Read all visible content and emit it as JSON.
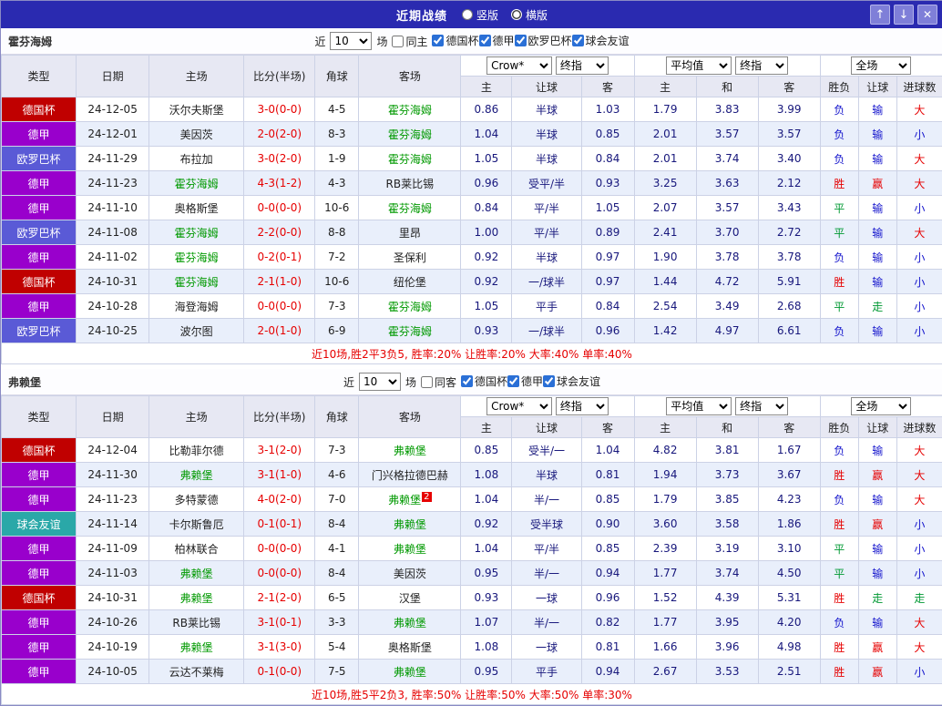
{
  "title_bar": {
    "title": "近期战绩",
    "layout_options": [
      {
        "label": "竖版",
        "selected": false
      },
      {
        "label": "横版",
        "selected": true
      }
    ],
    "buttons": {
      "up": "↑",
      "down": "↓",
      "close": "✕"
    }
  },
  "colors": {
    "red": "#e60000",
    "blue": "#1414cc",
    "green": "#009933",
    "league": {
      "德国杯": "#c00000",
      "德甲": "#9900cc",
      "欧罗巴杯": "#5a5ad6",
      "球会友谊": "#2aa8a8"
    }
  },
  "columns": {
    "type": "类型",
    "date": "日期",
    "home": "主场",
    "score": "比分(半场)",
    "corner": "角球",
    "away": "客场",
    "odds": [
      "主",
      "让球",
      "客"
    ],
    "avg": [
      "主",
      "和",
      "客"
    ],
    "result": [
      "胜负",
      "让球",
      "进球数"
    ]
  },
  "sections": [
    {
      "team": "霍芬海姆",
      "filter": {
        "near_label": "近",
        "count": "10",
        "games_label": "场",
        "same_label": "同主",
        "same_checked": false,
        "leagues": [
          {
            "label": "德国杯",
            "checked": true
          },
          {
            "label": "德甲",
            "checked": true
          },
          {
            "label": "欧罗巴杯",
            "checked": true
          },
          {
            "label": "球会友谊",
            "checked": true
          }
        ]
      },
      "selects": {
        "company": "Crow*",
        "company_time": "终指",
        "avg": "平均值",
        "avg_time": "终指",
        "scope": "全场"
      },
      "rows": [
        {
          "type": "德国杯",
          "date": "24-12-05",
          "home": "沃尔夫斯堡",
          "home_subject": false,
          "score": "3-0(0-0)",
          "corner": "4-5",
          "away": "霍芬海姆",
          "away_subject": true,
          "odds": [
            "0.86",
            "半球",
            "1.03"
          ],
          "avg": [
            "1.79",
            "3.83",
            "3.99"
          ],
          "results": [
            [
              "负",
              "blue"
            ],
            [
              "输",
              "blue"
            ],
            [
              "大",
              "red"
            ]
          ]
        },
        {
          "type": "德甲",
          "date": "24-12-01",
          "home": "美因茨",
          "home_subject": false,
          "score": "2-0(2-0)",
          "corner": "8-3",
          "away": "霍芬海姆",
          "away_subject": true,
          "odds": [
            "1.04",
            "半球",
            "0.85"
          ],
          "avg": [
            "2.01",
            "3.57",
            "3.57"
          ],
          "results": [
            [
              "负",
              "blue"
            ],
            [
              "输",
              "blue"
            ],
            [
              "小",
              "blue"
            ]
          ]
        },
        {
          "type": "欧罗巴杯",
          "date": "24-11-29",
          "home": "布拉加",
          "home_subject": false,
          "score": "3-0(2-0)",
          "corner": "1-9",
          "away": "霍芬海姆",
          "away_subject": true,
          "odds": [
            "1.05",
            "半球",
            "0.84"
          ],
          "avg": [
            "2.01",
            "3.74",
            "3.40"
          ],
          "results": [
            [
              "负",
              "blue"
            ],
            [
              "输",
              "blue"
            ],
            [
              "大",
              "red"
            ]
          ]
        },
        {
          "type": "德甲",
          "date": "24-11-23",
          "home": "霍芬海姆",
          "home_subject": true,
          "score": "4-3(1-2)",
          "corner": "4-3",
          "away": "RB莱比锡",
          "away_subject": false,
          "odds": [
            "0.96",
            "受平/半",
            "0.93"
          ],
          "avg": [
            "3.25",
            "3.63",
            "2.12"
          ],
          "results": [
            [
              "胜",
              "red"
            ],
            [
              "赢",
              "red"
            ],
            [
              "大",
              "red"
            ]
          ]
        },
        {
          "type": "德甲",
          "date": "24-11-10",
          "home": "奥格斯堡",
          "home_subject": false,
          "score": "0-0(0-0)",
          "corner": "10-6",
          "away": "霍芬海姆",
          "away_subject": true,
          "odds": [
            "0.84",
            "平/半",
            "1.05"
          ],
          "avg": [
            "2.07",
            "3.57",
            "3.43"
          ],
          "results": [
            [
              "平",
              "green"
            ],
            [
              "输",
              "blue"
            ],
            [
              "小",
              "blue"
            ]
          ]
        },
        {
          "type": "欧罗巴杯",
          "date": "24-11-08",
          "home": "霍芬海姆",
          "home_subject": true,
          "score": "2-2(0-0)",
          "corner": "8-8",
          "away": "里昂",
          "away_subject": false,
          "odds": [
            "1.00",
            "平/半",
            "0.89"
          ],
          "avg": [
            "2.41",
            "3.70",
            "2.72"
          ],
          "results": [
            [
              "平",
              "green"
            ],
            [
              "输",
              "blue"
            ],
            [
              "大",
              "red"
            ]
          ]
        },
        {
          "type": "德甲",
          "date": "24-11-02",
          "home": "霍芬海姆",
          "home_subject": true,
          "score": "0-2(0-1)",
          "corner": "7-2",
          "away": "圣保利",
          "away_subject": false,
          "odds": [
            "0.92",
            "半球",
            "0.97"
          ],
          "avg": [
            "1.90",
            "3.78",
            "3.78"
          ],
          "results": [
            [
              "负",
              "blue"
            ],
            [
              "输",
              "blue"
            ],
            [
              "小",
              "blue"
            ]
          ]
        },
        {
          "type": "德国杯",
          "date": "24-10-31",
          "home": "霍芬海姆",
          "home_subject": true,
          "score": "2-1(1-0)",
          "corner": "10-6",
          "away": "纽伦堡",
          "away_subject": false,
          "odds": [
            "0.92",
            "一/球半",
            "0.97"
          ],
          "avg": [
            "1.44",
            "4.72",
            "5.91"
          ],
          "results": [
            [
              "胜",
              "red"
            ],
            [
              "输",
              "blue"
            ],
            [
              "小",
              "blue"
            ]
          ]
        },
        {
          "type": "德甲",
          "date": "24-10-28",
          "home": "海登海姆",
          "home_subject": false,
          "score": "0-0(0-0)",
          "corner": "7-3",
          "away": "霍芬海姆",
          "away_subject": true,
          "odds": [
            "1.05",
            "平手",
            "0.84"
          ],
          "avg": [
            "2.54",
            "3.49",
            "2.68"
          ],
          "results": [
            [
              "平",
              "green"
            ],
            [
              "走",
              "green"
            ],
            [
              "小",
              "blue"
            ]
          ]
        },
        {
          "type": "欧罗巴杯",
          "date": "24-10-25",
          "home": "波尔图",
          "home_subject": false,
          "score": "2-0(1-0)",
          "corner": "6-9",
          "away": "霍芬海姆",
          "away_subject": true,
          "odds": [
            "0.93",
            "一/球半",
            "0.96"
          ],
          "avg": [
            "1.42",
            "4.97",
            "6.61"
          ],
          "results": [
            [
              "负",
              "blue"
            ],
            [
              "输",
              "blue"
            ],
            [
              "小",
              "blue"
            ]
          ]
        }
      ],
      "summary": "近10场,胜2平3负5, 胜率:20% 让胜率:20% 大率:40% 单率:40%"
    },
    {
      "team": "弗赖堡",
      "filter": {
        "near_label": "近",
        "count": "10",
        "games_label": "场",
        "same_label": "同客",
        "same_checked": false,
        "leagues": [
          {
            "label": "德国杯",
            "checked": true
          },
          {
            "label": "德甲",
            "checked": true
          },
          {
            "label": "球会友谊",
            "checked": true
          }
        ]
      },
      "selects": {
        "company": "Crow*",
        "company_time": "终指",
        "avg": "平均值",
        "avg_time": "终指",
        "scope": "全场"
      },
      "rows": [
        {
          "type": "德国杯",
          "date": "24-12-04",
          "home": "比勒菲尔德",
          "home_subject": false,
          "score": "3-1(2-0)",
          "corner": "7-3",
          "away": "弗赖堡",
          "away_subject": true,
          "odds": [
            "0.85",
            "受半/一",
            "1.04"
          ],
          "avg": [
            "4.82",
            "3.81",
            "1.67"
          ],
          "results": [
            [
              "负",
              "blue"
            ],
            [
              "输",
              "blue"
            ],
            [
              "大",
              "red"
            ]
          ]
        },
        {
          "type": "德甲",
          "date": "24-11-30",
          "home": "弗赖堡",
          "home_subject": true,
          "score": "3-1(1-0)",
          "corner": "4-6",
          "away": "门兴格拉德巴赫",
          "away_subject": false,
          "odds": [
            "1.08",
            "半球",
            "0.81"
          ],
          "avg": [
            "1.94",
            "3.73",
            "3.67"
          ],
          "results": [
            [
              "胜",
              "red"
            ],
            [
              "赢",
              "red"
            ],
            [
              "大",
              "red"
            ]
          ]
        },
        {
          "type": "德甲",
          "date": "24-11-23",
          "home": "多特蒙德",
          "home_subject": false,
          "score": "4-0(2-0)",
          "corner": "7-0",
          "away": "弗赖堡",
          "away_subject": true,
          "away_badge": "2",
          "odds": [
            "1.04",
            "半/一",
            "0.85"
          ],
          "avg": [
            "1.79",
            "3.85",
            "4.23"
          ],
          "results": [
            [
              "负",
              "blue"
            ],
            [
              "输",
              "blue"
            ],
            [
              "大",
              "red"
            ]
          ]
        },
        {
          "type": "球会友谊",
          "date": "24-11-14",
          "home": "卡尔斯鲁厄",
          "home_subject": false,
          "score": "0-1(0-1)",
          "corner": "8-4",
          "away": "弗赖堡",
          "away_subject": true,
          "odds": [
            "0.92",
            "受半球",
            "0.90"
          ],
          "avg": [
            "3.60",
            "3.58",
            "1.86"
          ],
          "results": [
            [
              "胜",
              "red"
            ],
            [
              "赢",
              "red"
            ],
            [
              "小",
              "blue"
            ]
          ]
        },
        {
          "type": "德甲",
          "date": "24-11-09",
          "home": "柏林联合",
          "home_subject": false,
          "score": "0-0(0-0)",
          "corner": "4-1",
          "away": "弗赖堡",
          "away_subject": true,
          "odds": [
            "1.04",
            "平/半",
            "0.85"
          ],
          "avg": [
            "2.39",
            "3.19",
            "3.10"
          ],
          "results": [
            [
              "平",
              "green"
            ],
            [
              "输",
              "blue"
            ],
            [
              "小",
              "blue"
            ]
          ]
        },
        {
          "type": "德甲",
          "date": "24-11-03",
          "home": "弗赖堡",
          "home_subject": true,
          "score": "0-0(0-0)",
          "corner": "8-4",
          "away": "美因茨",
          "away_subject": false,
          "odds": [
            "0.95",
            "半/一",
            "0.94"
          ],
          "avg": [
            "1.77",
            "3.74",
            "4.50"
          ],
          "results": [
            [
              "平",
              "green"
            ],
            [
              "输",
              "blue"
            ],
            [
              "小",
              "blue"
            ]
          ]
        },
        {
          "type": "德国杯",
          "date": "24-10-31",
          "home": "弗赖堡",
          "home_subject": true,
          "score": "2-1(2-0)",
          "corner": "6-5",
          "away": "汉堡",
          "away_subject": false,
          "odds": [
            "0.93",
            "一球",
            "0.96"
          ],
          "avg": [
            "1.52",
            "4.39",
            "5.31"
          ],
          "results": [
            [
              "胜",
              "red"
            ],
            [
              "走",
              "green"
            ],
            [
              "走",
              "green"
            ]
          ]
        },
        {
          "type": "德甲",
          "date": "24-10-26",
          "home": "RB莱比锡",
          "home_subject": false,
          "score": "3-1(0-1)",
          "corner": "3-3",
          "away": "弗赖堡",
          "away_subject": true,
          "odds": [
            "1.07",
            "半/一",
            "0.82"
          ],
          "avg": [
            "1.77",
            "3.95",
            "4.20"
          ],
          "results": [
            [
              "负",
              "blue"
            ],
            [
              "输",
              "blue"
            ],
            [
              "大",
              "red"
            ]
          ]
        },
        {
          "type": "德甲",
          "date": "24-10-19",
          "home": "弗赖堡",
          "home_subject": true,
          "score": "3-1(3-0)",
          "corner": "5-4",
          "away": "奥格斯堡",
          "away_subject": false,
          "odds": [
            "1.08",
            "一球",
            "0.81"
          ],
          "avg": [
            "1.66",
            "3.96",
            "4.98"
          ],
          "results": [
            [
              "胜",
              "red"
            ],
            [
              "赢",
              "red"
            ],
            [
              "大",
              "red"
            ]
          ]
        },
        {
          "type": "德甲",
          "date": "24-10-05",
          "home": "云达不莱梅",
          "home_subject": false,
          "score": "0-1(0-0)",
          "corner": "7-5",
          "away": "弗赖堡",
          "away_subject": true,
          "odds": [
            "0.95",
            "平手",
            "0.94"
          ],
          "avg": [
            "2.67",
            "3.53",
            "2.51"
          ],
          "results": [
            [
              "胜",
              "red"
            ],
            [
              "赢",
              "red"
            ],
            [
              "小",
              "blue"
            ]
          ]
        }
      ],
      "summary": "近10场,胜5平2负3, 胜率:50% 让胜率:50% 大率:50% 单率:30%"
    }
  ]
}
